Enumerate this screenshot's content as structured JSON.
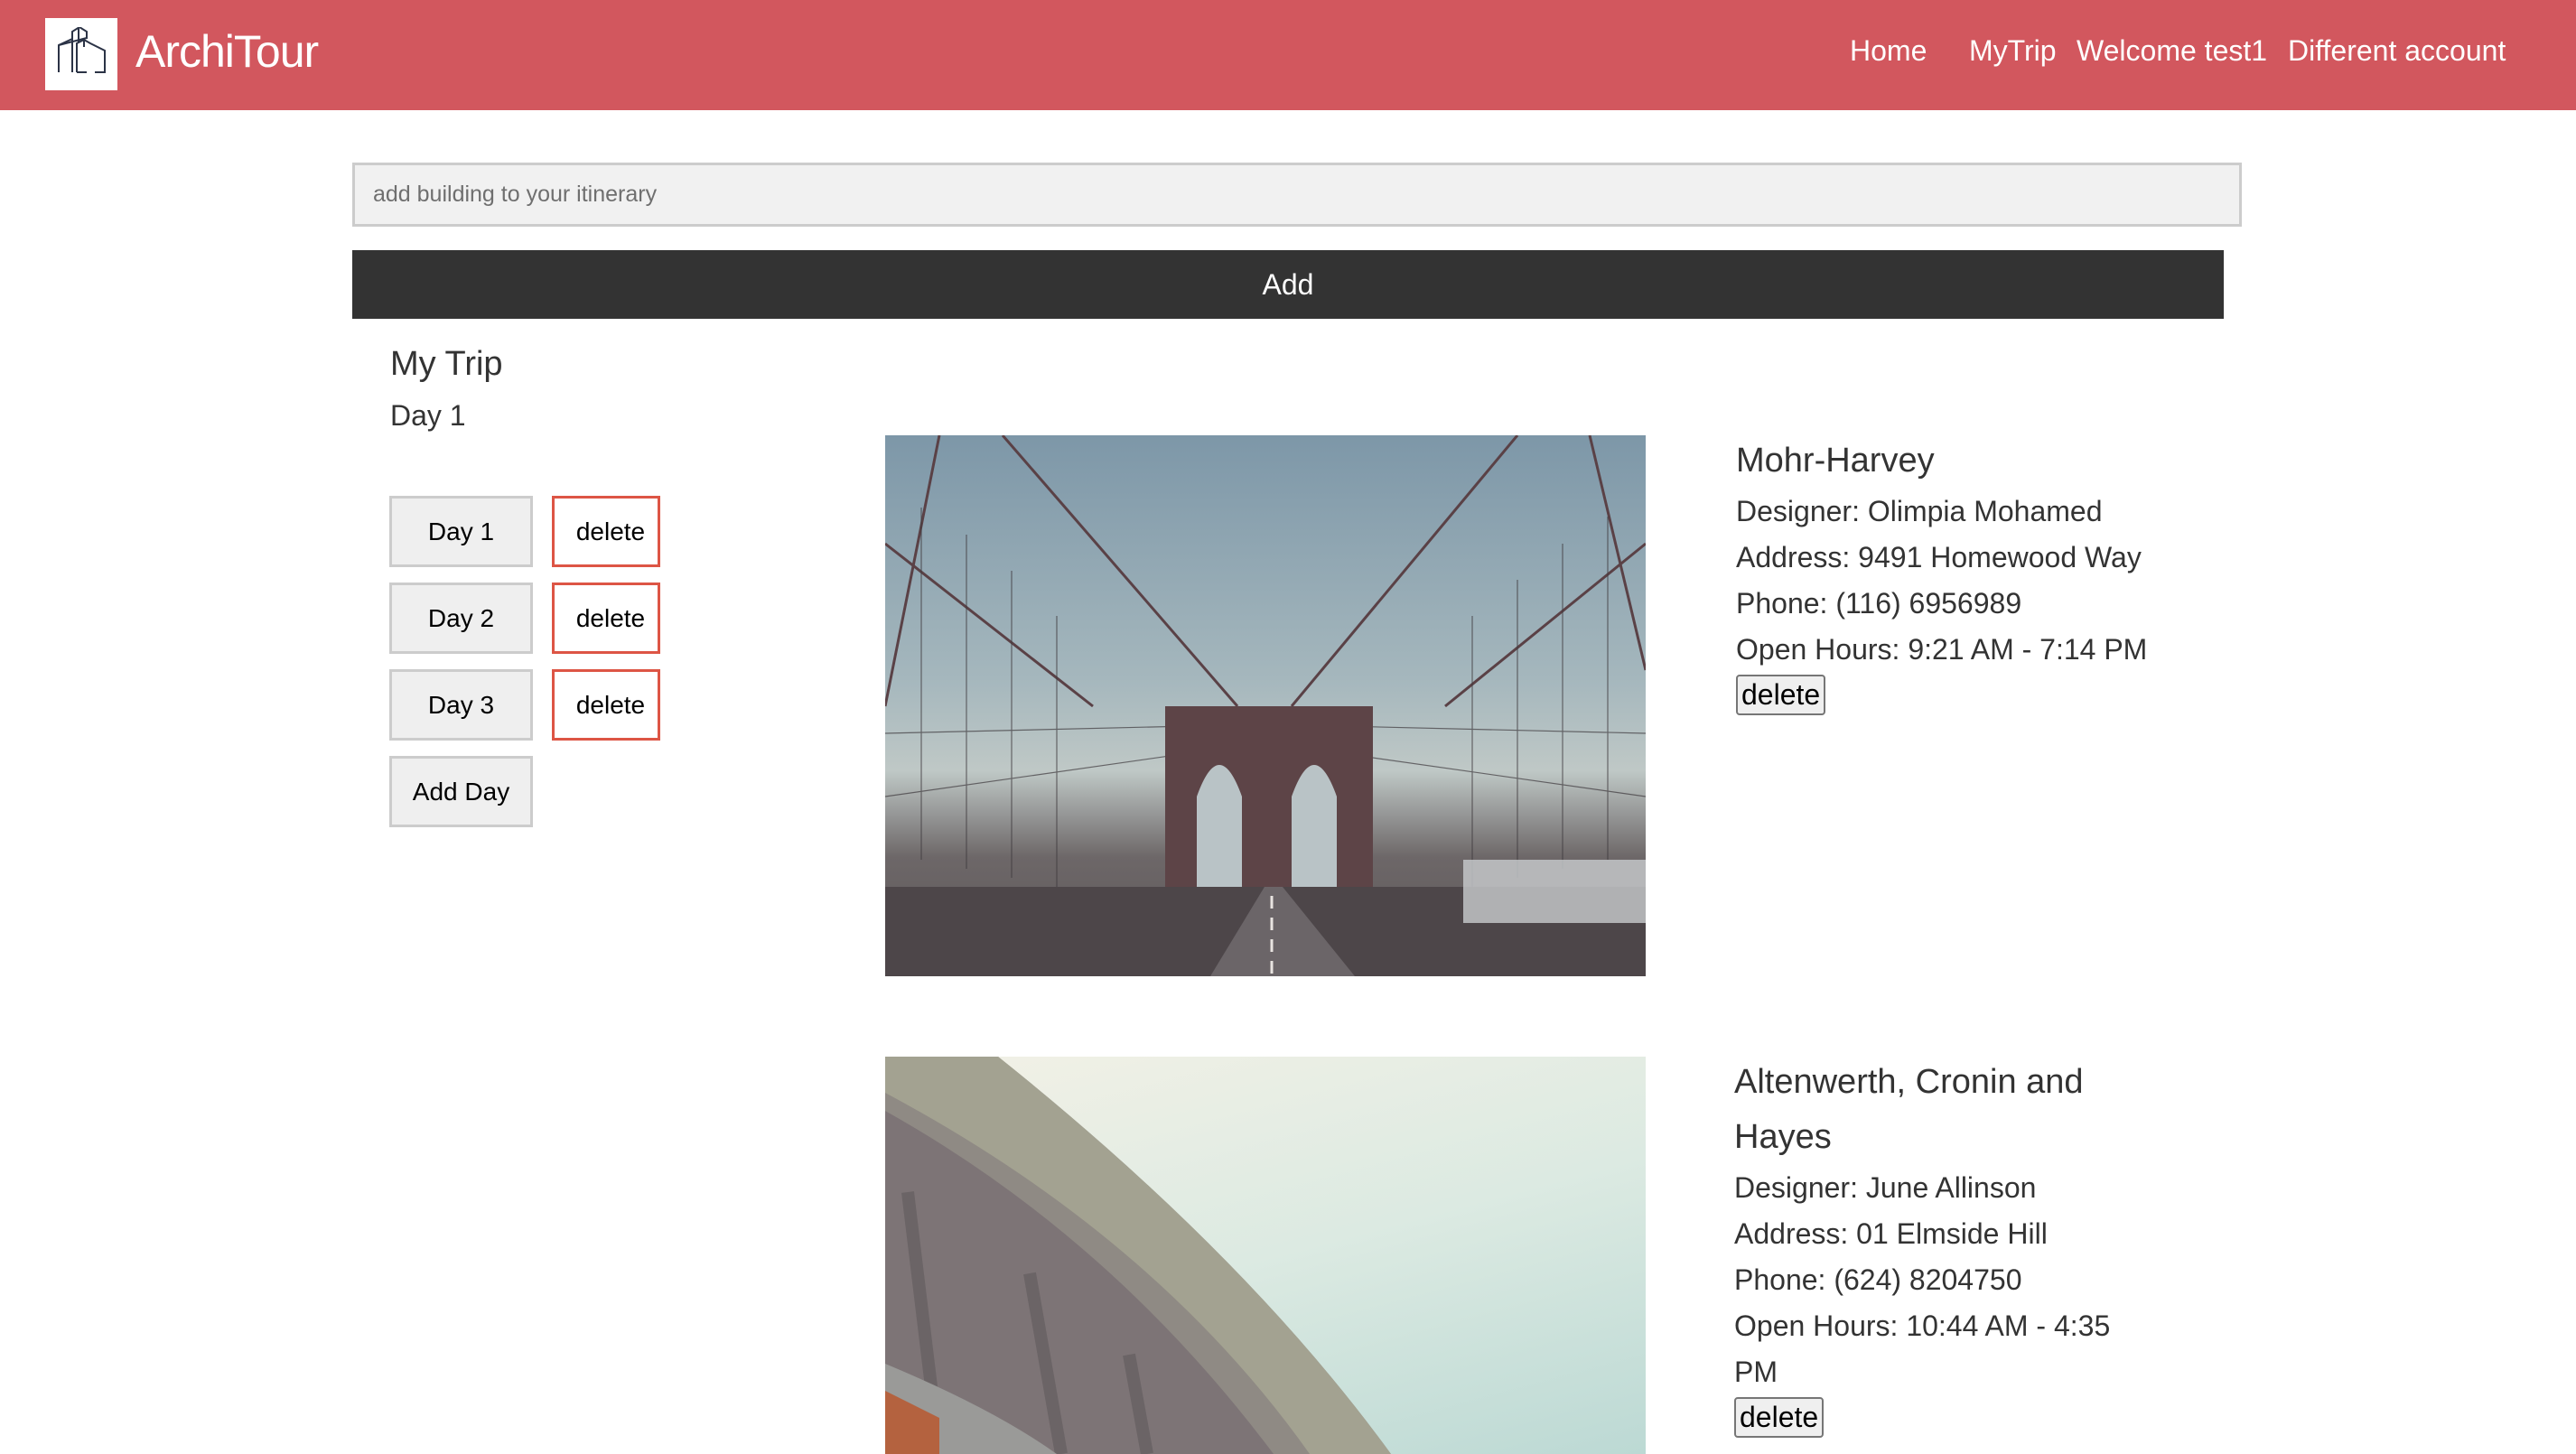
{
  "header": {
    "logo_icon": "building-outline-icon",
    "brand": "ArchiTour",
    "nav": {
      "home": "Home",
      "mytrip": "MyTrip",
      "welcome": "Welcome test1",
      "different_account": "Different account"
    },
    "colors": {
      "background": "#d2575e",
      "text": "#ffffff"
    }
  },
  "search": {
    "placeholder": "add building to your itinerary",
    "value": ""
  },
  "add_button": {
    "label": "Add",
    "color": "#333333"
  },
  "trip": {
    "title": "My Trip",
    "current_day": "Day 1",
    "days": [
      {
        "label": "Day 1",
        "delete_label": "delete"
      },
      {
        "label": "Day 2",
        "delete_label": "delete"
      },
      {
        "label": "Day 3",
        "delete_label": "delete"
      }
    ],
    "add_day_label": "Add Day",
    "delete_border_color": "#dd5545"
  },
  "buildings": [
    {
      "image": "brooklyn-bridge-photo",
      "name": "Mohr-Harvey",
      "designer": "Designer: Olimpia Mohamed",
      "address": "Address: 9491 Homewood Way",
      "phone": "Phone: (116) 6956989",
      "hours": "Open Hours: 9:21 AM - 7:14 PM",
      "delete_label": "delete"
    },
    {
      "image": "curved-concrete-structure-photo",
      "name": "Altenwerth, Cronin and Hayes",
      "designer": "Designer: June Allinson",
      "address": "Address: 01 Elmside Hill",
      "phone": "Phone: (624) 8204750",
      "hours": "Open Hours: 10:44 AM - 4:35 PM",
      "delete_label": "delete"
    }
  ]
}
